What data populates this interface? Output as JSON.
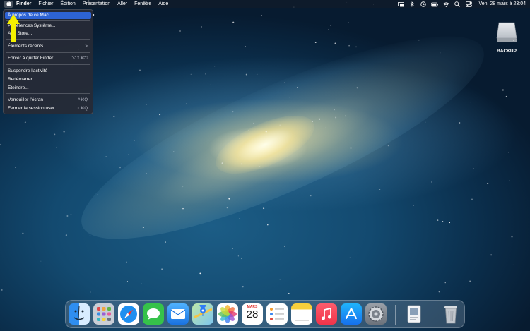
{
  "menubar": {
    "apple_glyph": "",
    "items": [
      "Finder",
      "Fichier",
      "Édition",
      "Présentation",
      "Aller",
      "Fenêtre",
      "Aide"
    ],
    "clock": "Ven. 28 mars à 23:04",
    "status_icons": [
      "screen-mirroring-icon",
      "bluetooth-icon",
      "time-machine-icon",
      "battery-icon",
      "wifi-icon",
      "search-icon",
      "control-center-icon"
    ]
  },
  "apple_menu": {
    "items": [
      {
        "label": "À propos de ce Mac",
        "shortcut": "",
        "selected": true
      },
      {
        "label": "Préférences Système...",
        "shortcut": ""
      },
      {
        "label": "App Store...",
        "shortcut": ""
      },
      {
        "label": "Éléments récents",
        "shortcut": ">"
      },
      {
        "label": "Forcer à quitter Finder",
        "shortcut": "⌥⇧⌘⎋"
      },
      {
        "label": "Suspendre l'activité",
        "shortcut": ""
      },
      {
        "label": "Redémarrer...",
        "shortcut": ""
      },
      {
        "label": "Éteindre...",
        "shortcut": ""
      },
      {
        "label": "Verrouiller l'écran",
        "shortcut": "^⌘Q"
      },
      {
        "label": "Fermer la session user...",
        "shortcut": "⇧⌘Q"
      }
    ]
  },
  "desktop": {
    "drive_label": "BACKUP"
  },
  "dock": {
    "apps": [
      "Finder",
      "Launchpad",
      "Safari",
      "Messages",
      "Mail",
      "Plans",
      "Photos",
      "Calendrier",
      "Rappels",
      "Notes",
      "Musique",
      "App Store",
      "Préférences Système",
      "Aperçu",
      "Corbeille"
    ],
    "calendar_month": "MARS",
    "calendar_day": "28"
  },
  "colors": {
    "menu_highlight": "#2d63d4",
    "arrow": "#f4f000"
  }
}
